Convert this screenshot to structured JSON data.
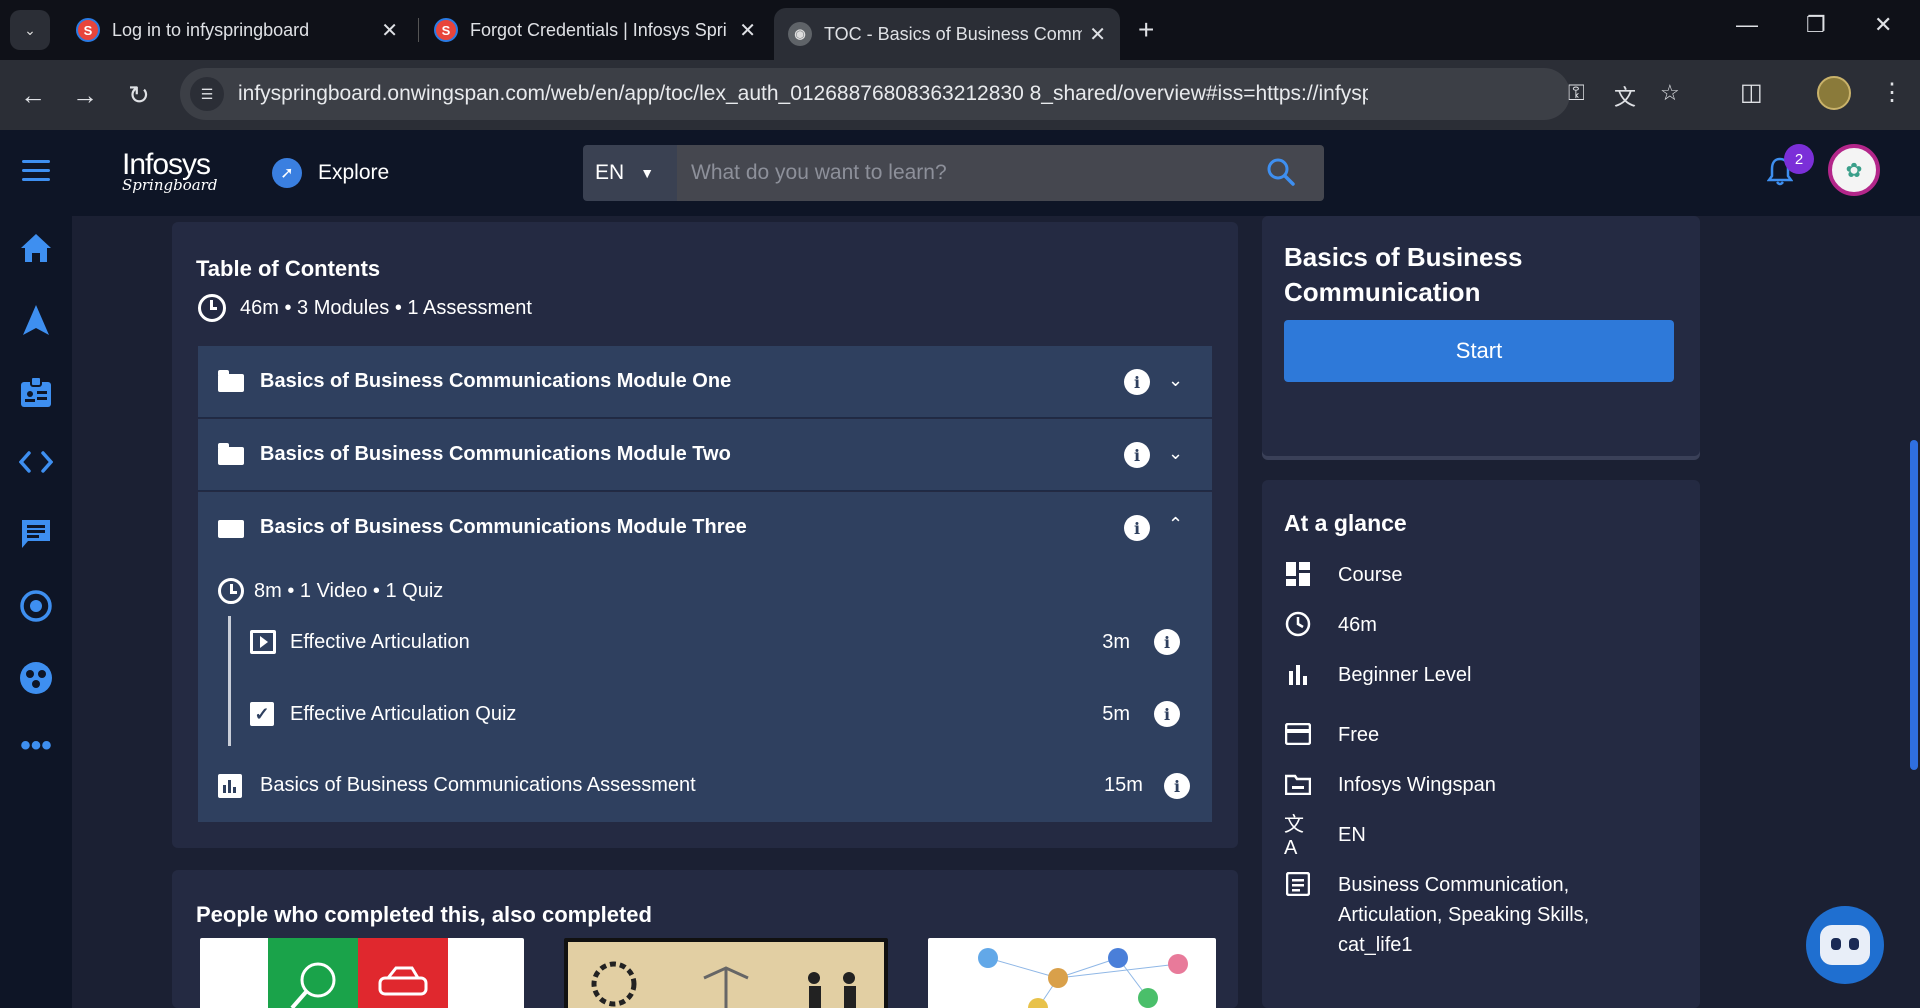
{
  "browser": {
    "tabs": [
      {
        "title": "Log in to infyspringboard",
        "icon": "springboard-favicon"
      },
      {
        "title": "Forgot Credentials | Infosys Springboard",
        "icon": "springboard-favicon"
      },
      {
        "title": "TOC - Basics of Business Communication",
        "icon": "globe-icon",
        "active": true
      }
    ],
    "url": "infyspringboard.onwingspan.com/web/en/app/toc/lex_auth_01268876808363212830 8_shared/overview#iss=https://infyspringboard.onwings..."
  },
  "header": {
    "logo_line1": "Infosys",
    "logo_line2": "Springboard",
    "explore_label": "Explore",
    "language": "EN",
    "search_placeholder": "What do you want to learn?",
    "notification_count": "2"
  },
  "toc": {
    "title": "Table of Contents",
    "summary": "46m • 3 Modules • 1 Assessment",
    "modules": [
      {
        "title": "Basics of Business Communications Module One",
        "expanded": false
      },
      {
        "title": "Basics of Business Communications Module Two",
        "expanded": false
      },
      {
        "title": "Basics of Business Communications Module Three",
        "expanded": true,
        "summary": "8m • 1 Video • 1 Quiz",
        "items": [
          {
            "title": "Effective Articulation",
            "duration": "3m",
            "icon": "video-icon"
          },
          {
            "title": "Effective Articulation Quiz",
            "duration": "5m",
            "icon": "quiz-icon"
          }
        ]
      }
    ],
    "assessment": {
      "title": "Basics of Business Communications Assessment",
      "duration": "15m"
    }
  },
  "people": {
    "title": "People who completed this, also completed"
  },
  "course": {
    "title": "Basics of Business Communication",
    "start_label": "Start"
  },
  "glance": {
    "title": "At a glance",
    "rows": [
      {
        "icon": "dashboard-icon",
        "text": "Course"
      },
      {
        "icon": "clock-icon",
        "text": "46m"
      },
      {
        "icon": "level-icon",
        "text": "Beginner Level"
      },
      {
        "icon": "card-icon",
        "text": "Free"
      },
      {
        "icon": "folder-icon",
        "text": "Infosys Wingspan"
      },
      {
        "icon": "translate-icon",
        "text": "EN"
      },
      {
        "icon": "tags-icon",
        "text": "Business Communication, Articulation, Speaking Skills, cat_life1"
      }
    ]
  },
  "colors": {
    "accent": "#2e79d9",
    "header_bg": "#0e1526",
    "card_bg": "#242a42",
    "module_bg": "#2f405f",
    "badge": "#7b2fd8"
  }
}
